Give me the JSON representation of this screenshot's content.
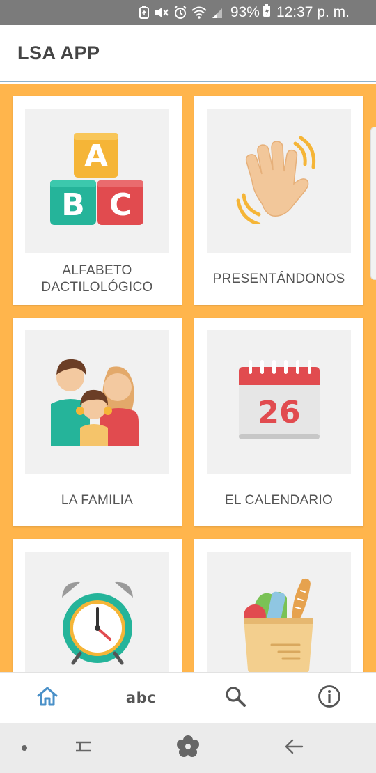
{
  "status_bar": {
    "battery_percent": "93%",
    "time": "12:37 p. m.",
    "icons": [
      "sync-icon",
      "mute-icon",
      "alarm-icon",
      "wifi-icon",
      "signal-icon",
      "battery-charging-icon"
    ]
  },
  "app_bar": {
    "title": "LSA APP"
  },
  "categories": [
    {
      "label": "ALFABETO DACTILOLÓGICO",
      "icon": "abc-blocks-icon"
    },
    {
      "label": "PRESENTÁNDONOS",
      "icon": "waving-hand-icon"
    },
    {
      "label": "LA FAMILIA",
      "icon": "family-icon"
    },
    {
      "label": "EL CALENDARIO",
      "icon": "calendar-icon",
      "calendar_day": "26"
    },
    {
      "label": "",
      "icon": "alarm-clock-icon"
    },
    {
      "label": "",
      "icon": "grocery-bag-icon"
    }
  ],
  "bottom_nav": {
    "home_icon": "home-icon",
    "abc_label": "abc",
    "search_icon": "search-icon",
    "info_icon": "info-icon",
    "active": "home",
    "active_color": "#4a90c8",
    "inactive_color": "#555555"
  },
  "system_nav": {
    "icons": [
      "dot-icon",
      "recent-apps-icon",
      "home-flower-icon",
      "back-icon"
    ]
  },
  "colors": {
    "background": "#ffb54c",
    "status_bar": "#7b7b7b",
    "card": "#ffffff",
    "thumb": "#f1f1f1"
  }
}
